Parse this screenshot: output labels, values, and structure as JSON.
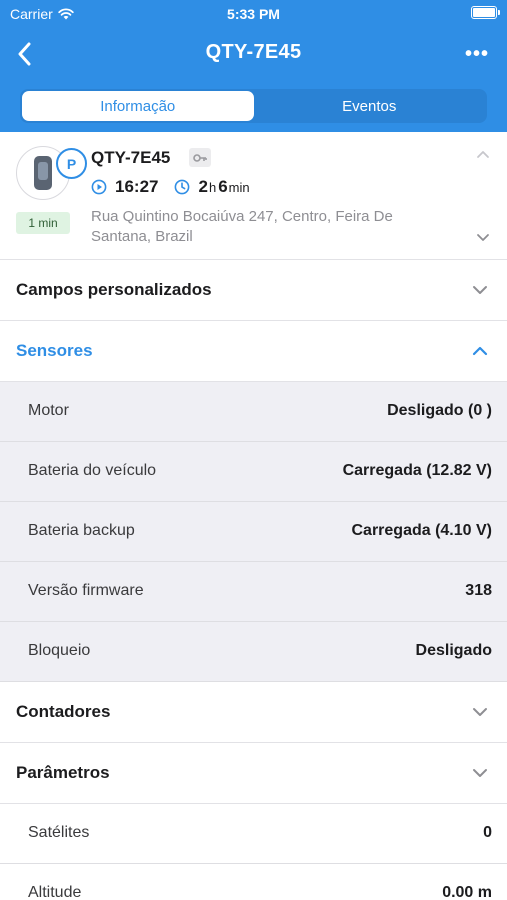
{
  "status_bar": {
    "carrier": "Carrier",
    "time": "5:33 PM"
  },
  "nav": {
    "title": "QTY-7E45",
    "more": "•••"
  },
  "tabs": [
    {
      "label": "Informação",
      "active": true
    },
    {
      "label": "Eventos",
      "active": false
    }
  ],
  "vehicle": {
    "name": "QTY-7E45",
    "parking_badge": "P",
    "age_badge": "1 min",
    "time": "16:27",
    "duration_hours": "2",
    "duration_hours_unit": "h",
    "duration_minutes": "6",
    "duration_minutes_unit": "min",
    "address": "Rua Quintino Bocaiúva 247, Centro, Feira De Santana, Brazil"
  },
  "sections": {
    "custom_fields": "Campos personalizados",
    "sensors": "Sensores",
    "counters": "Contadores",
    "parameters": "Parâmetros"
  },
  "sensors": [
    {
      "label": "Motor",
      "value": "Desligado (0 )"
    },
    {
      "label": "Bateria do veículo",
      "value": "Carregada (12.82 V)"
    },
    {
      "label": "Bateria backup",
      "value": "Carregada (4.10 V)"
    },
    {
      "label": "Versão firmware",
      "value": "318"
    },
    {
      "label": "Bloqueio",
      "value": "Desligado"
    }
  ],
  "parameters": [
    {
      "label": "Satélites",
      "value": "0"
    },
    {
      "label": "Altitude",
      "value": "0.00 m"
    }
  ],
  "colors": {
    "primary": "#2f8ee5",
    "badge_green_bg": "#dff3e2",
    "sensor_bg": "#efeff4"
  }
}
